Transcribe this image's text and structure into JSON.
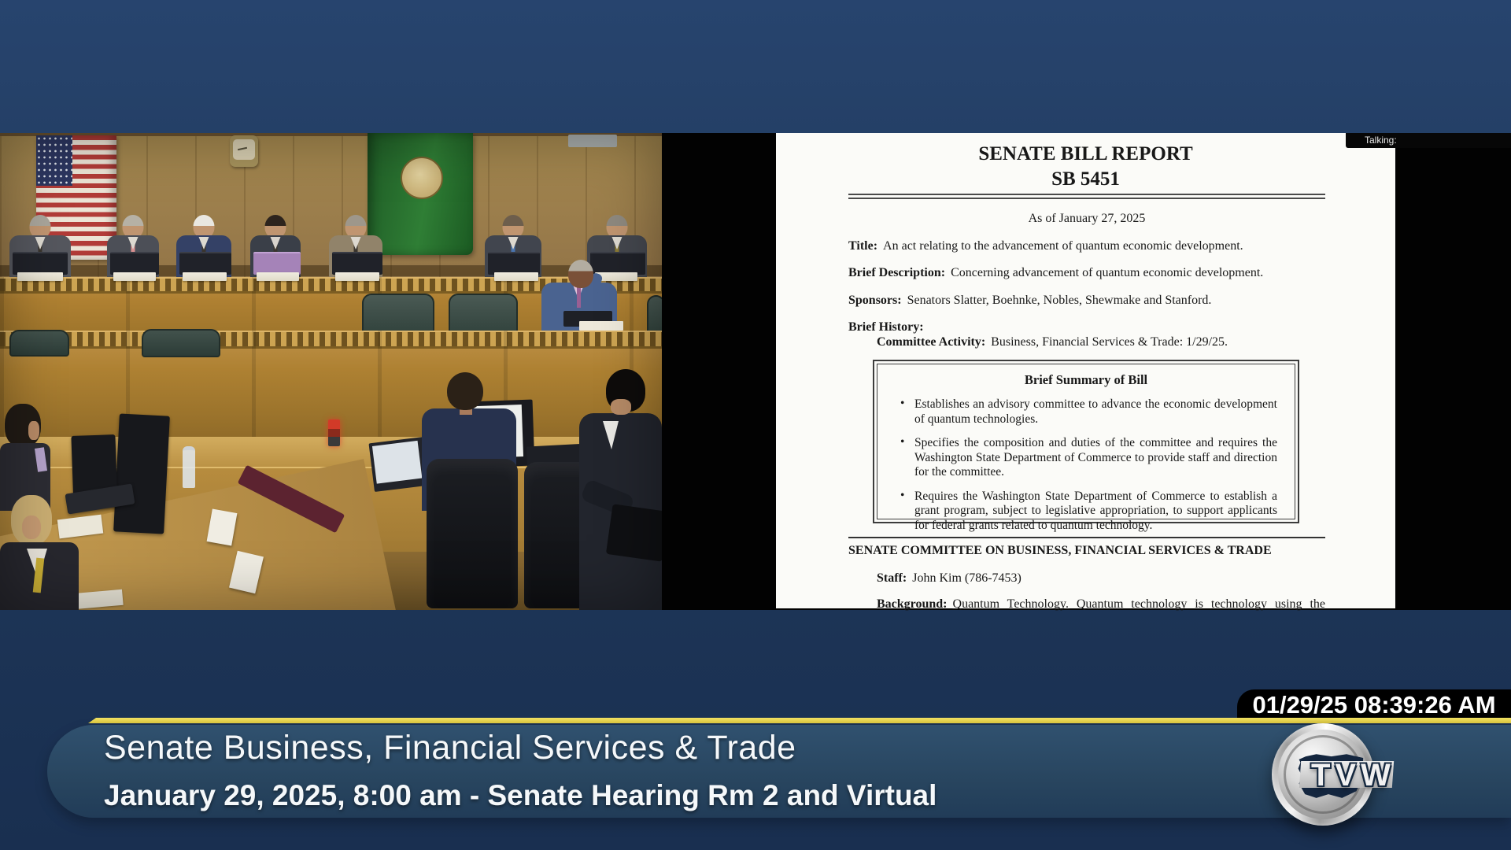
{
  "document": {
    "heading1": "SENATE BILL REPORT",
    "heading2": "SB 5451",
    "as_of": "As of January 27, 2025",
    "fields": {
      "title_label": "Title:",
      "title_text": "An act relating to the advancement of quantum economic development.",
      "brief_description_label": "Brief Description:",
      "brief_description_text": "Concerning advancement of quantum economic development.",
      "sponsors_label": "Sponsors:",
      "sponsors_text": "Senators Slatter, Boehnke, Nobles, Shewmake and Stanford.",
      "brief_history_label": "Brief History:",
      "committee_activity_label": "Committee Activity:",
      "committee_activity_text": "Business, Financial Services & Trade: 1/29/25."
    },
    "summary_box": {
      "heading": "Brief Summary of Bill",
      "bullet_char": "•",
      "bullets": [
        "Establishes an advisory committee to advance the economic development of quantum technologies.",
        "Specifies the composition and duties of the committee and requires the Washington State Department of Commerce to provide staff and direction for the committee.",
        "Requires the Washington State Department of Commerce to establish a grant program, subject to legislative appropriation, to support applicants for federal grants related to quantum technology."
      ]
    },
    "committee_heading": "SENATE COMMITTEE ON BUSINESS, FINANCIAL SERVICES & TRADE",
    "staff_label": "Staff:",
    "staff_text": "John Kim (786-7453)",
    "background_label": "Background:",
    "background_link_text": "Quantum Technology.",
    "background_text": "Quantum technology is technology using the"
  },
  "video_overlay": {
    "talking_label": "Talking:"
  },
  "status_bar": {
    "timestamp": "01/29/25 08:39:26 AM"
  },
  "banner": {
    "title": "Senate Business, Financial Services & Trade",
    "subtitle": "January 29, 2025, 8:00 am - Senate Hearing Rm 2 and Virtual"
  },
  "logo": {
    "text": "TVW"
  },
  "colors": {
    "background_navy": "#223c60",
    "banner_blue": "#2c4c6c",
    "accent_yellow": "#e8d84f",
    "timestamp_bg": "#000000",
    "talking_bg": "#070707",
    "page_bg": "#fbfbf8",
    "share_bg": "#020202",
    "flag_green": "#2f7e35",
    "flag_red": "#b23c38",
    "dais_oak": "#ae8132"
  }
}
